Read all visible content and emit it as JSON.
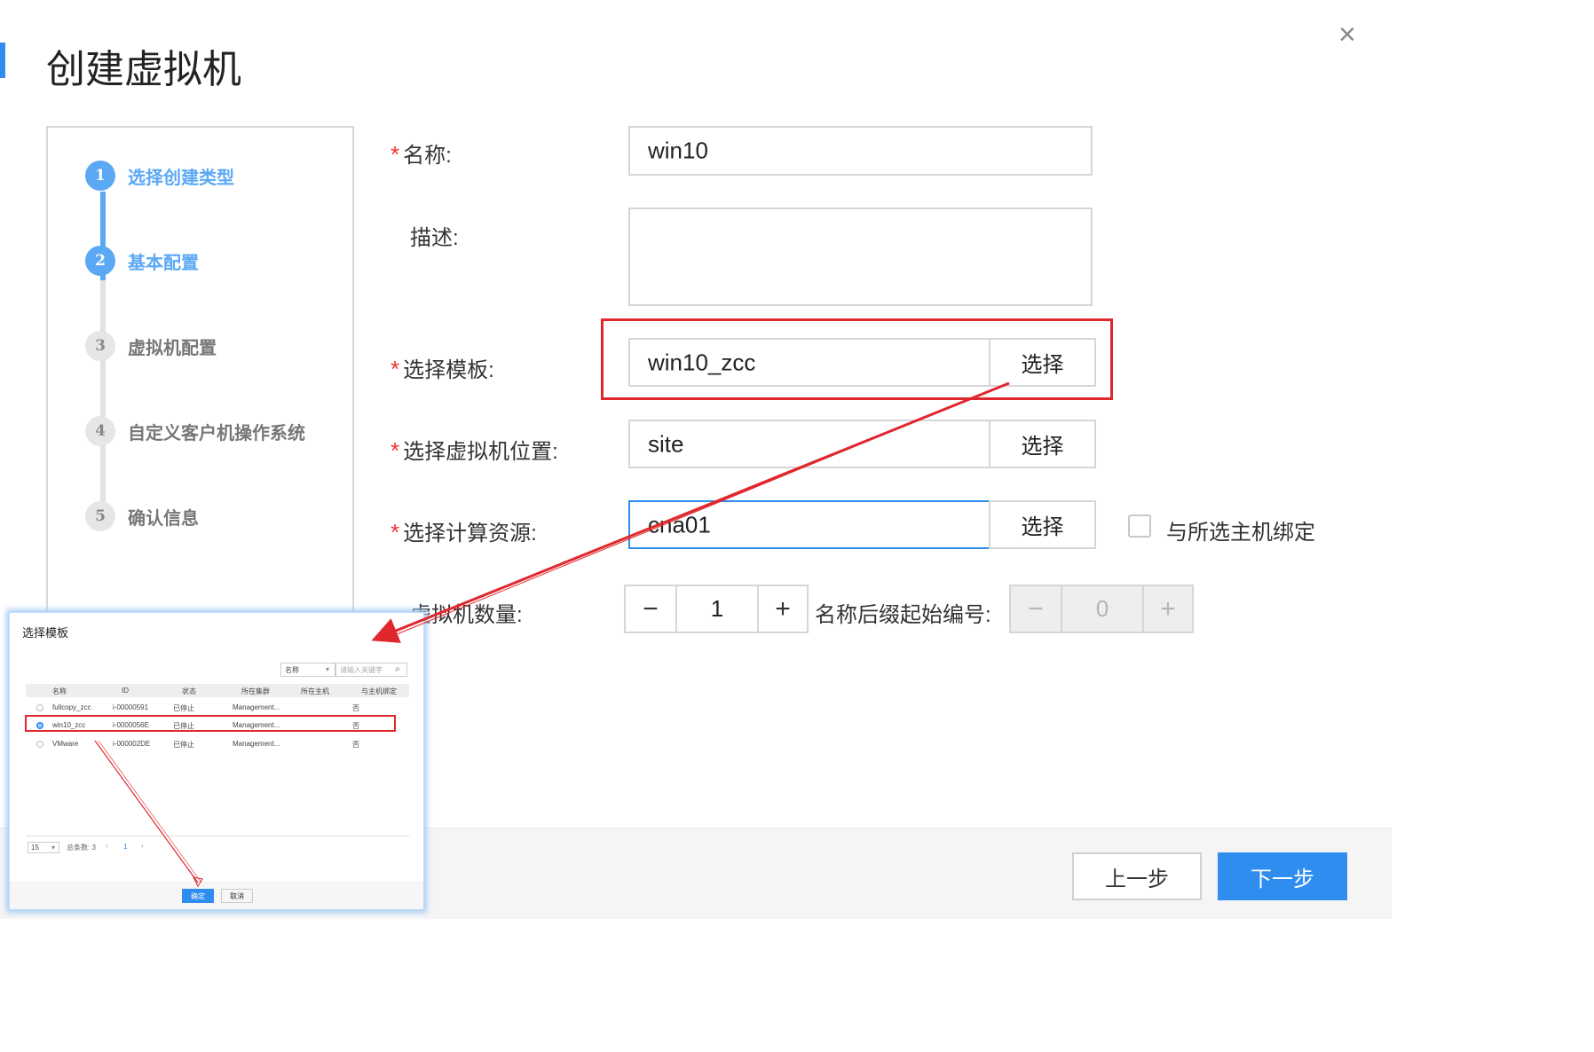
{
  "dialog": {
    "title": "创建虚拟机",
    "close_label": "×"
  },
  "steps": [
    {
      "num": "1",
      "label": "选择创建类型",
      "state": "done"
    },
    {
      "num": "2",
      "label": "基本配置",
      "state": "active"
    },
    {
      "num": "3",
      "label": "虚拟机配置",
      "state": "pending"
    },
    {
      "num": "4",
      "label": "自定义客户机操作系统",
      "state": "pending"
    },
    {
      "num": "5",
      "label": "确认信息",
      "state": "pending"
    }
  ],
  "form": {
    "required_mark": "*",
    "name": {
      "label": "名称:",
      "value": "win10"
    },
    "description": {
      "label": "描述:",
      "value": ""
    },
    "template": {
      "label": "选择模板:",
      "value": "win10_zcc",
      "button": "选择"
    },
    "location": {
      "label": "选择虚拟机位置:",
      "value": "site",
      "button": "选择"
    },
    "compute": {
      "label": "选择计算资源:",
      "value": "cna01",
      "button": "选择",
      "bind_label": "与所选主机绑定"
    },
    "count": {
      "label": "虚拟机数量:",
      "value": "1",
      "minus": "−",
      "plus": "+"
    },
    "suffix": {
      "label": "名称后缀起始编号:",
      "value": "0",
      "minus": "−",
      "plus": "+"
    }
  },
  "footer": {
    "prev": "上一步",
    "next": "下一步"
  },
  "inset": {
    "title": "选择模板",
    "filter_value": "名称",
    "search_placeholder": "请输入关键字",
    "columns": [
      "名称",
      "ID",
      "状态",
      "所在集群",
      "所在主机",
      "与主机绑定"
    ],
    "rows": [
      {
        "name": "fullcopy_zcc",
        "id": "i-00000591",
        "status": "已停止",
        "cluster": "Management...",
        "host": "",
        "bind": "否"
      },
      {
        "name": "win10_zcc",
        "id": "i-0000056E",
        "status": "已停止",
        "cluster": "Management...",
        "host": "",
        "bind": "否"
      },
      {
        "name": "VMware",
        "id": "i-000002DE",
        "status": "已停止",
        "cluster": "Management...",
        "host": "",
        "bind": "否"
      }
    ],
    "page_size": "15",
    "total": "总条数: 3",
    "prev_page": "‹",
    "page": "1",
    "next_page": "›",
    "ok": "确定",
    "cancel": "取消"
  },
  "colors": {
    "accent": "#2e8def",
    "step_active": "#5ba8f5",
    "annotation": "#e0272e"
  }
}
